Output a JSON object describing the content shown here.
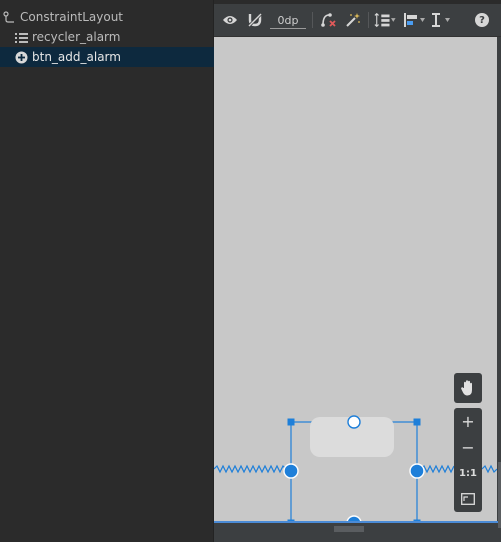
{
  "component_tree": {
    "items": [
      {
        "label": "ConstraintLayout",
        "icon": "constraint-layout-icon"
      },
      {
        "label": "recycler_alarm",
        "icon": "list-icon"
      },
      {
        "label": "btn_add_alarm",
        "icon": "add-circle-icon",
        "selected": true
      }
    ]
  },
  "toolbar": {
    "buttons": [
      {
        "name": "view-options-icon"
      },
      {
        "name": "autoconnect-magnet-icon"
      },
      {
        "name": "clear-constraints-icon"
      },
      {
        "name": "infer-constraints-wand-icon"
      },
      {
        "name": "pack-icon"
      },
      {
        "name": "align-icon"
      },
      {
        "name": "guidelines-icon"
      },
      {
        "name": "help-icon"
      }
    ],
    "default_margin": "0dp",
    "help_label": "?"
  },
  "zoom_panel": {
    "pan": "hand-icon",
    "zoom_in": "+",
    "zoom_out": "−",
    "actual_size": "1:1",
    "zoom_to_fit": "fit-screen-icon"
  },
  "colors": {
    "accent": "#1e7fd9",
    "canvas": "#c8c8c8",
    "selection": "#0d293e",
    "panel": "#3c3f41"
  }
}
